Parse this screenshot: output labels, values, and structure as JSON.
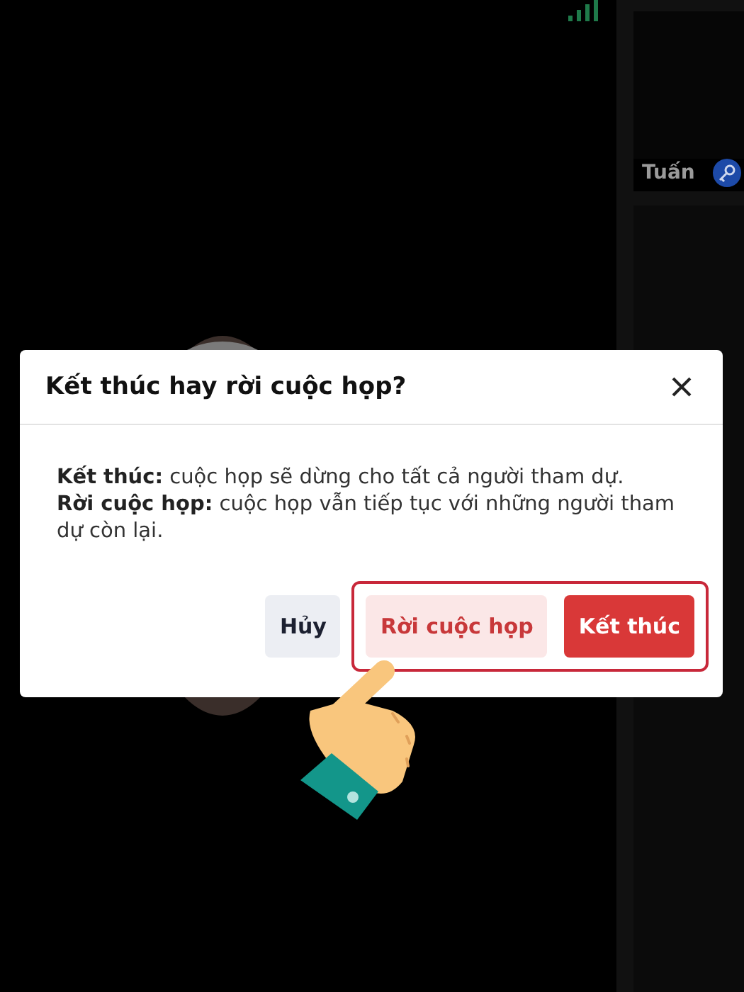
{
  "sidebar": {
    "tiles": [
      {
        "name": "Tuấn"
      }
    ]
  },
  "dialog": {
    "title": "Kết thúc hay rời cuộc họp?",
    "message_lines": [
      "**Kết thúc:** cuộc họp sẽ dừng cho tất cả người tham dự.",
      "**Rời cuộc họp:** cuộc họp vẫn tiếp tục với những người tham dự còn lại."
    ],
    "buttons": [
      {
        "label": "Hủy",
        "kind": "neutral",
        "highlighted": false
      },
      {
        "label": "Rời cuộc họp",
        "kind": "leave",
        "highlighted": true
      },
      {
        "label": "Kết thúc",
        "kind": "end",
        "highlighted": true
      }
    ]
  }
}
